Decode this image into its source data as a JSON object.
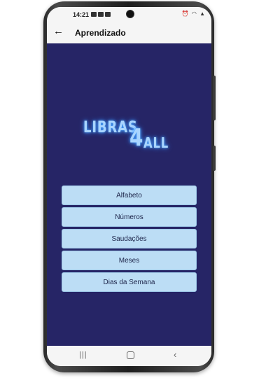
{
  "status_bar": {
    "time": "14:21",
    "left_icons": [
      "notification-icon",
      "notification-icon",
      "notification-icon"
    ],
    "right_icons": [
      "alarm-icon",
      "wifi-icon",
      "signal-icon"
    ]
  },
  "app_bar": {
    "back_icon": "arrow-left-icon",
    "title": "Aprendizado"
  },
  "logo": {
    "part1": "LIBRAS",
    "part2": "4",
    "part3": "ALL"
  },
  "menu": {
    "items": [
      {
        "label": "Alfabeto"
      },
      {
        "label": "Números"
      },
      {
        "label": "Saudações"
      },
      {
        "label": "Meses"
      },
      {
        "label": "Dias da Semana"
      }
    ]
  },
  "nav_bar": {
    "recents_icon": "recents-icon",
    "home_icon": "home-icon",
    "back_icon": "back-icon"
  },
  "colors": {
    "background": "#262566",
    "button": "#bcddf5",
    "logo_glow": "#4aa8ff"
  }
}
